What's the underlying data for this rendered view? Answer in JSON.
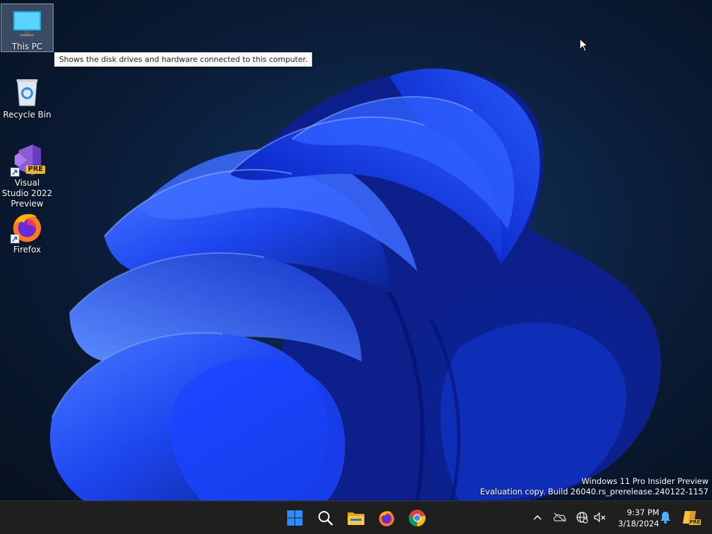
{
  "desktop": {
    "icons": [
      {
        "label": "This PC",
        "icon": "monitor-icon"
      },
      {
        "label": "Recycle Bin",
        "icon": "recycle-bin-icon"
      },
      {
        "label": "Visual Studio 2022 Preview",
        "icon": "visual-studio-icon",
        "badge": "PRE"
      },
      {
        "label": "Firefox",
        "icon": "firefox-icon"
      }
    ],
    "tooltip": "Shows the disk drives and hardware connected to this computer.",
    "watermark": {
      "line1": "Windows 11 Pro Insider Preview",
      "line2": "Evaluation copy. Build 26040.rs_prerelease.240122-1157"
    }
  },
  "taskbar": {
    "apps": [
      "start-icon",
      "search-icon",
      "file-explorer-icon",
      "firefox-icon",
      "chrome-icon"
    ],
    "tray": [
      "chevron-up-icon",
      "onedrive-offline-icon",
      "network-icon",
      "volume-muted-icon",
      "notification-bell-icon",
      "copilot-icon"
    ],
    "copilot_badge": "PRE",
    "clock": {
      "time": "9:37 PM",
      "date": "3/18/2024"
    }
  },
  "colors": {
    "wallpaper_accent": "#1f4fff",
    "wallpaper_bg": "#0a1a33",
    "taskbar_bg": "#1f1f1f",
    "start_blue": "#2f8cff"
  }
}
